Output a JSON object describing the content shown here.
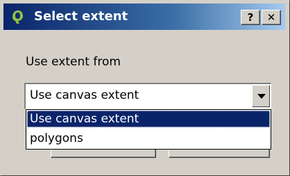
{
  "window": {
    "title": "Select extent",
    "help_label": "?",
    "close_label": "✕"
  },
  "form": {
    "extent_label": "Use extent from",
    "combo_value": "Use canvas extent",
    "options": [
      {
        "label": "Use canvas extent",
        "selected": true
      },
      {
        "label": "polygons",
        "selected": false
      }
    ]
  },
  "colors": {
    "titlebar_start": "#0a246a",
    "titlebar_end": "#a6caf0",
    "selection": "#0a246a",
    "dialog_bg": "#d4d0c8",
    "app_icon": "#8fc440"
  }
}
